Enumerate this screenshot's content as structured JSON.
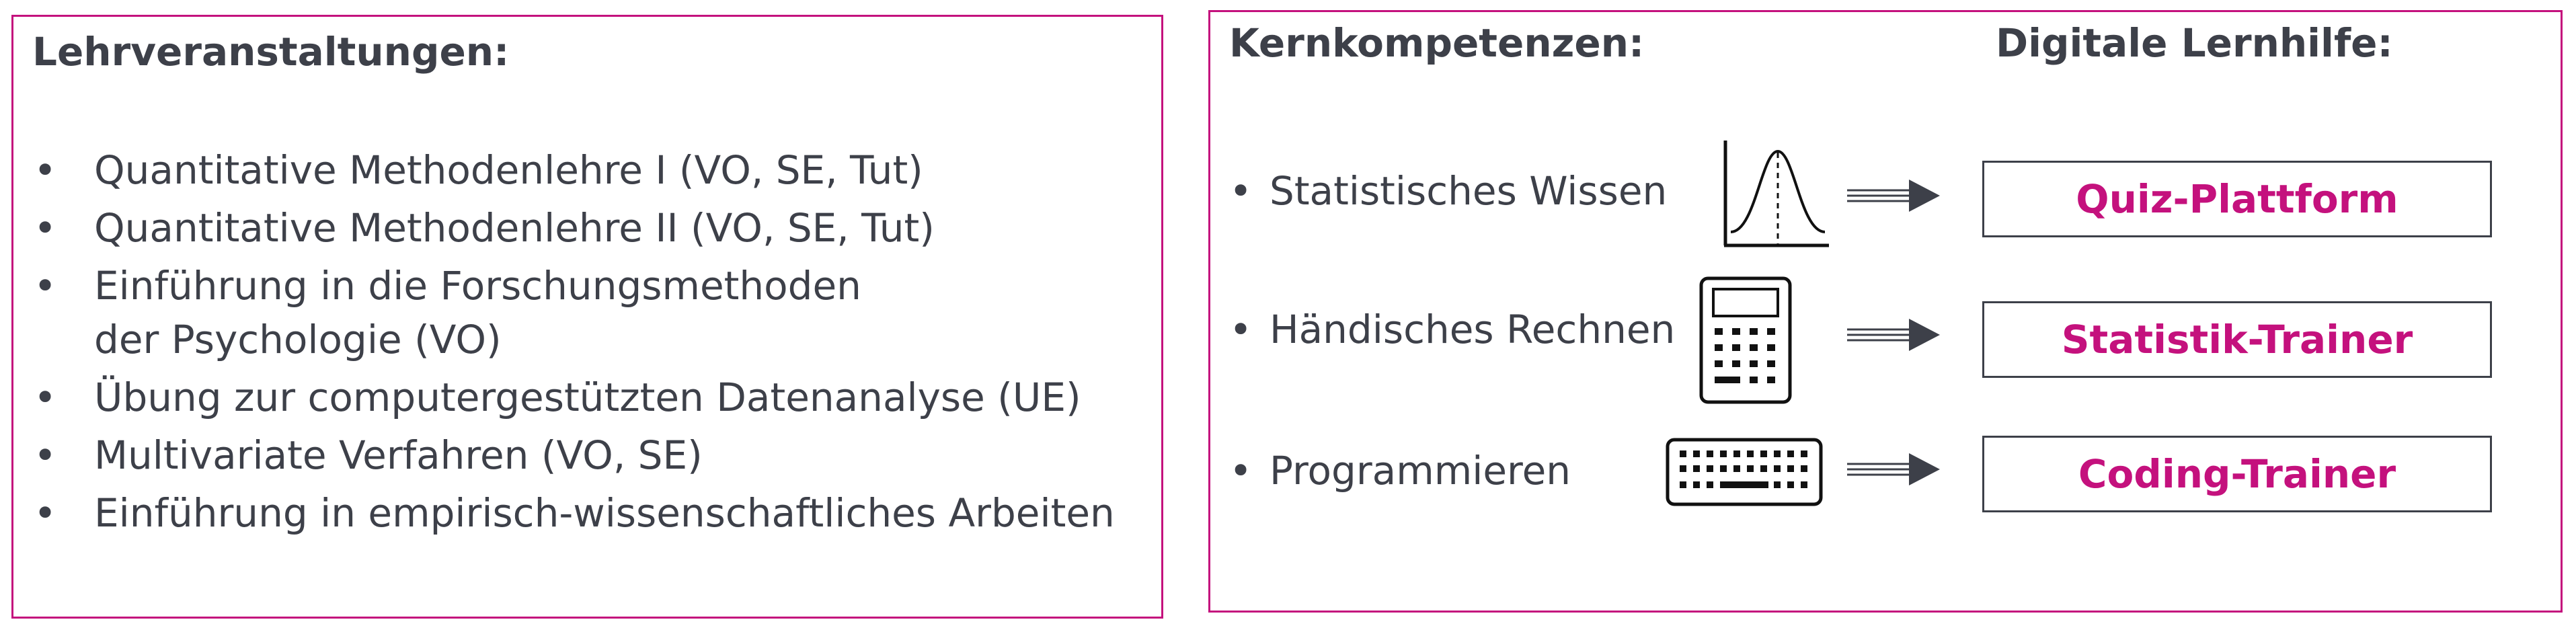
{
  "left": {
    "heading": "Lehrveranstaltungen:",
    "courses": [
      {
        "line1": "Quantitative Methodenlehre I (VO, SE, Tut)"
      },
      {
        "line1": "Quantitative Methodenlehre II (VO, SE, Tut)"
      },
      {
        "line1": "Einführung in die Forschungsmethoden",
        "line2": "der Psychologie (VO)"
      },
      {
        "line1": "Übung zur computergestützten Datenanalyse (UE)"
      },
      {
        "line1": "Multivariate Verfahren (VO, SE)"
      },
      {
        "line1": "Einführung in empirisch-wissenschaftliches Arbeiten"
      }
    ]
  },
  "right": {
    "heading_left": "Kernkompetenzen:",
    "heading_right": "Digitale Lernhilfe:",
    "rows": [
      {
        "competence": "Statistisches Wissen",
        "icon": "bell-curve-icon",
        "tool": "Quiz-Plattform"
      },
      {
        "competence": "Händisches Rechnen",
        "icon": "calculator-icon",
        "tool": "Statistik-Trainer"
      },
      {
        "competence": "Programmieren",
        "icon": "keyboard-icon",
        "tool": "Coding-Trainer"
      }
    ]
  },
  "colors": {
    "accent": "#c4117d",
    "text": "#3d4049"
  }
}
